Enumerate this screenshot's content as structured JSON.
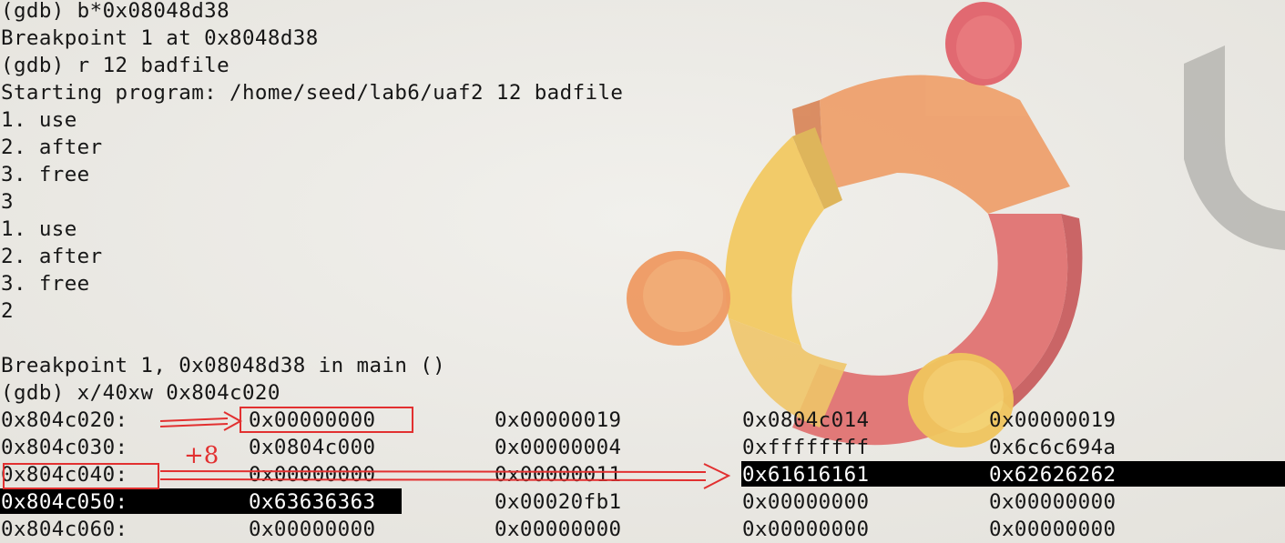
{
  "terminal": {
    "lines": [
      "(gdb) b*0x08048d38",
      "Breakpoint 1 at 0x8048d38",
      "(gdb) r 12 badfile",
      "Starting program: /home/seed/lab6/uaf2 12 badfile",
      "1. use",
      "2. after",
      "3. free",
      "3",
      "1. use",
      "2. after",
      "3. free",
      "2",
      "",
      "Breakpoint 1, 0x08048d38 in main ()",
      "(gdb) x/40xw 0x804c020"
    ],
    "memory_rows": [
      {
        "addr": "0x804c020:",
        "words": [
          "0x00000000",
          "0x00000019",
          "0x0804c014",
          "0x00000019"
        ]
      },
      {
        "addr": "0x804c030:",
        "words": [
          "0x0804c000",
          "0x00000004",
          "0xffffffff",
          "0x6c6c694a"
        ]
      },
      {
        "addr": "0x804c040:",
        "words": [
          "0x00000000",
          "0x00000011",
          "0x61616161",
          "0x62626262"
        ]
      },
      {
        "addr": "0x804c050:",
        "words": [
          "0x63636363",
          "0x00020fb1",
          "0x00000000",
          "0x00000000"
        ]
      },
      {
        "addr": "0x804c060:",
        "words": [
          "0x00000000",
          "0x00000000",
          "0x00000000",
          "0x00000000"
        ]
      }
    ]
  },
  "annotations": {
    "offset_label": "+8",
    "color": "#e23030"
  },
  "colors": {
    "background": "#ecebe7",
    "text": "#161616",
    "highlight_bg": "#000000",
    "highlight_fg": "#ffffff",
    "logo_orange": "#ef9a63",
    "logo_yellow": "#f2c866",
    "logo_red": "#df6b6f"
  },
  "icons": {
    "wallpaper": "ubuntu-logo-icon"
  }
}
